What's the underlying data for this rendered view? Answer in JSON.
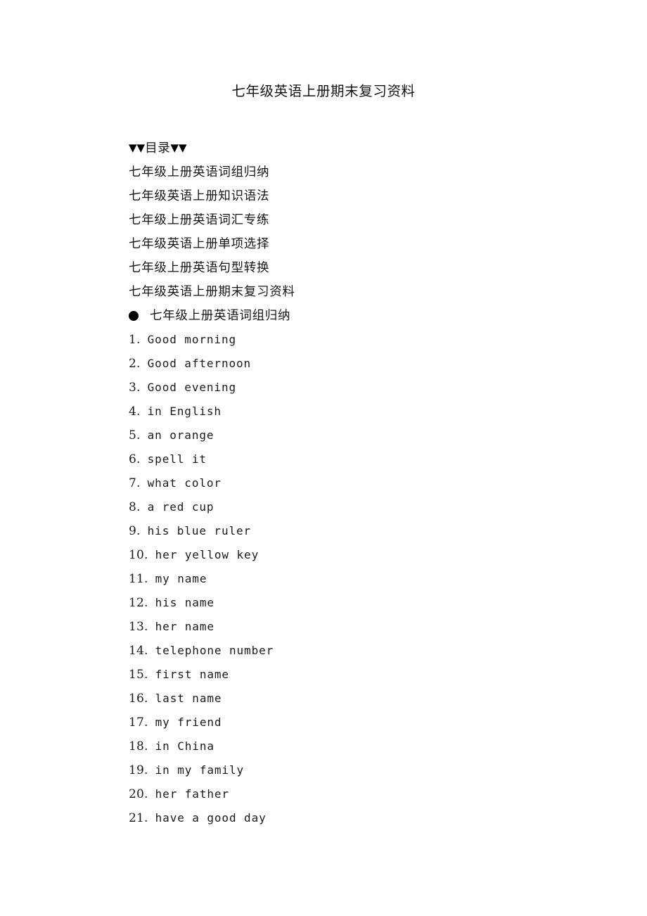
{
  "document": {
    "title": "七年级英语上册期末复习资料"
  },
  "toc": {
    "heading_triangle_left": "▼▼",
    "heading_label": "目录",
    "heading_triangle_right": "▼▼",
    "items": [
      "七年级上册英语词组归纳",
      "七年级英语上册知识语法",
      "七年级上册英语词汇专练",
      "七年级英语上册单项选择",
      "七年级上册英语句型转换",
      "七年级英语上册期末复习资料"
    ]
  },
  "section": {
    "bullet": "●",
    "heading": "七年级上册英语词组归纳"
  },
  "phrases": [
    {
      "num": "1.",
      "text": "Good morning"
    },
    {
      "num": "2.",
      "text": "Good afternoon"
    },
    {
      "num": "3.",
      "text": "Good evening"
    },
    {
      "num": "4.",
      "text": "in English"
    },
    {
      "num": "5.",
      "text": "an orange"
    },
    {
      "num": "6.",
      "text": "spell it"
    },
    {
      "num": "7.",
      "text": "what color"
    },
    {
      "num": "8.",
      "text": "a red cup"
    },
    {
      "num": "9.",
      "text": "his blue ruler"
    },
    {
      "num": "10.",
      "text": "her yellow key"
    },
    {
      "num": "11.",
      "text": "my name"
    },
    {
      "num": "12.",
      "text": "his name"
    },
    {
      "num": "13.",
      "text": "her name"
    },
    {
      "num": "14.",
      "text": "telephone number"
    },
    {
      "num": "15.",
      "text": "first name"
    },
    {
      "num": "16.",
      "text": "last name"
    },
    {
      "num": "17.",
      "text": "my friend"
    },
    {
      "num": "18.",
      "text": "in China"
    },
    {
      "num": "19.",
      "text": "in my family"
    },
    {
      "num": "20.",
      "text": "her father"
    },
    {
      "num": "21.",
      "text": "have a good day"
    }
  ],
  "colors": {
    "page_background": "#ffffff",
    "text": "#161616",
    "bullet": "#000000"
  }
}
